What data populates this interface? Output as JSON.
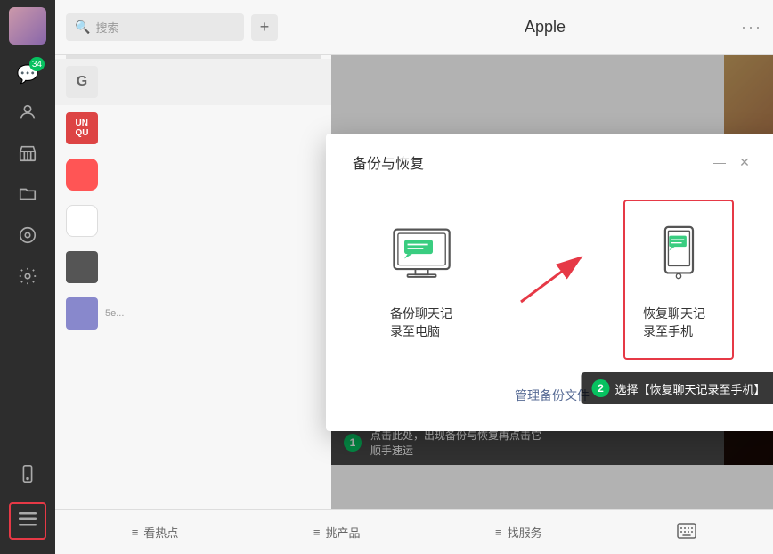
{
  "sidebar": {
    "avatar_alt": "user avatar",
    "badge_count": "34",
    "icons": [
      {
        "name": "chat-icon",
        "symbol": "💬",
        "badge": "34"
      },
      {
        "name": "contacts-icon",
        "symbol": "👤"
      },
      {
        "name": "store-icon",
        "symbol": "🏪"
      },
      {
        "name": "folder-icon",
        "symbol": "📁"
      },
      {
        "name": "settings-icon",
        "symbol": "⚙️"
      },
      {
        "name": "discover-icon",
        "symbol": "🔍"
      }
    ],
    "bottom_icons": [
      {
        "name": "phone-icon",
        "symbol": "📱"
      },
      {
        "name": "hamburger-icon",
        "symbol": "☰"
      }
    ]
  },
  "topbar": {
    "search_placeholder": "搜索",
    "add_button_label": "+",
    "title": "Apple",
    "more_label": "···"
  },
  "dialog": {
    "title": "备份与恢复",
    "minimize_label": "—",
    "close_label": "✕",
    "options": [
      {
        "id": "backup",
        "label": "备份聊天记录至电脑",
        "selected": false
      },
      {
        "id": "restore",
        "label": "恢复聊天记录至手机",
        "selected": true
      }
    ],
    "manage_link": "管理备份文件",
    "tooltip": {
      "num": "2",
      "text": "选择【恢复聊天记录至手机】"
    }
  },
  "annotation": {
    "num": "1",
    "text": "点击此处，出现备份与恢复再点击它\n顺手速运"
  },
  "bottom_nav": {
    "items": [
      {
        "label": "看热点",
        "icon": "≡"
      },
      {
        "label": "挑产品",
        "icon": "≡"
      },
      {
        "label": "找服务",
        "icon": "≡"
      },
      {
        "label": "键盘",
        "icon": "⌨"
      }
    ]
  }
}
